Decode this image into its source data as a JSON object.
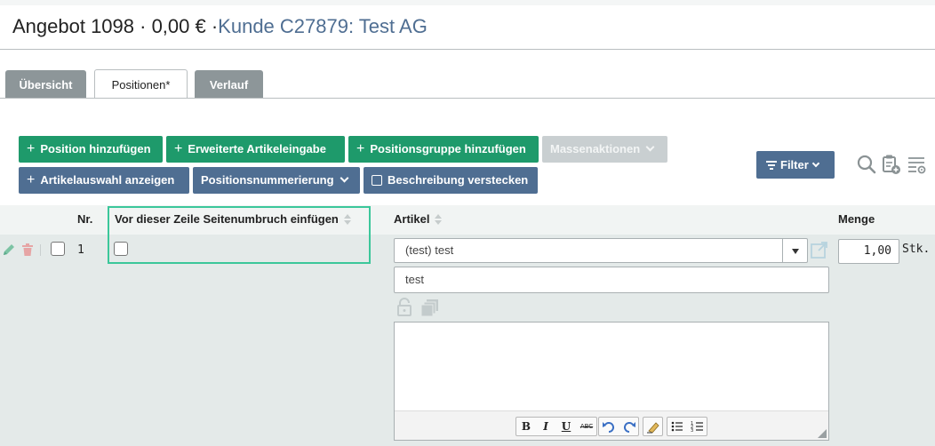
{
  "header": {
    "title_prefix": "Angebot 1098 · 0,00 € ·",
    "customer_link": "Kunde C27879: Test AG"
  },
  "tabs": [
    {
      "label": "Übersicht"
    },
    {
      "label": "Positionen*"
    },
    {
      "label": "Verlauf"
    }
  ],
  "toolbar": {
    "add_position": "Position hinzufügen",
    "extended_input": "Erweiterte Artikeleingabe",
    "add_group": "Positionsgruppe hinzufügen",
    "mass_actions": "Massenaktionen",
    "show_article_selection": "Artikelauswahl anzeigen",
    "position_numbering": "Positionsnummerierung",
    "hide_description": "Beschreibung verstecken",
    "filter": "Filter"
  },
  "table": {
    "headers": {
      "nr": "Nr.",
      "page_break": "Vor dieser Zeile Seitenumbruch einfügen",
      "article": "Artikel",
      "quantity": "Menge"
    },
    "rows": [
      {
        "nr": "1",
        "article_select": "(test) test",
        "article_name": "test",
        "quantity": "1,00",
        "unit": "Stk."
      }
    ]
  },
  "colors": {
    "green": "#1e9a6b",
    "blue": "#4f6e92",
    "highlight": "#3bc79a"
  }
}
